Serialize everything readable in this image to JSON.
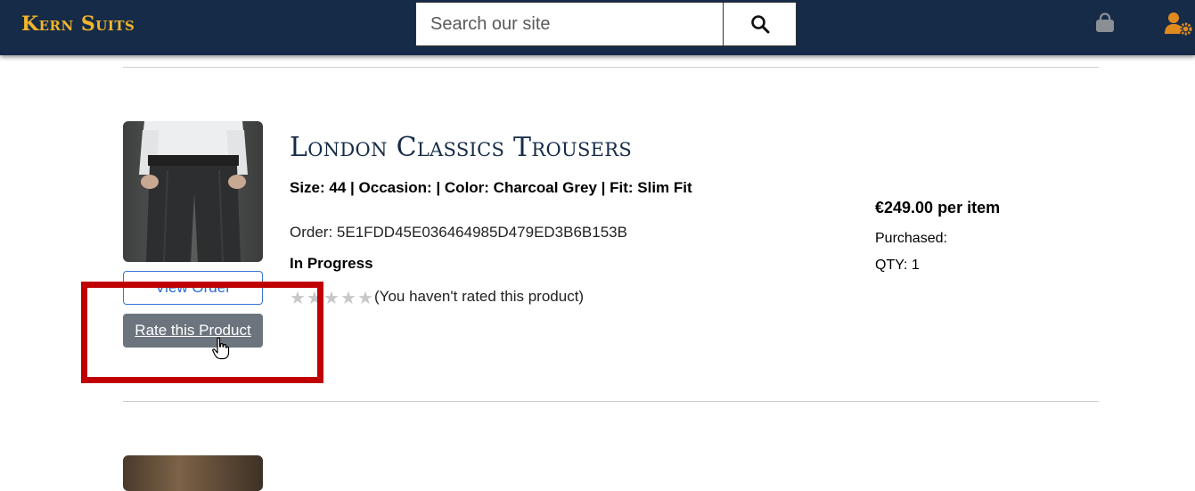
{
  "header": {
    "brand": "Kern Suits",
    "search": {
      "placeholder": "Search our site",
      "value": ""
    },
    "icons": {
      "search": "search-icon",
      "cart": "shopping-bag-icon",
      "account": "user-gear-icon"
    },
    "colors": {
      "background": "#162b48",
      "brand": "#f0b52a",
      "account_icon": "#e08a1e"
    }
  },
  "order_item": {
    "product_name": "London Classics Trousers",
    "attributes": "Size: 44 | Occasion: | Color: Charcoal Grey | Fit: Slim Fit",
    "order_label": "Order: 5E1FDD45E036464985D479ED3B6B153B",
    "status": "In Progress",
    "rating": {
      "stars": 0,
      "max": 5,
      "text": "(You haven't rated this product)"
    },
    "price": "€249.00 per item",
    "purchased_label": "Purchased:",
    "qty_label": "QTY: 1",
    "buttons": {
      "view_order": "View Order",
      "rate": "Rate this Product"
    }
  },
  "highlight": {
    "target": "rate-button",
    "color": "#c00000"
  }
}
